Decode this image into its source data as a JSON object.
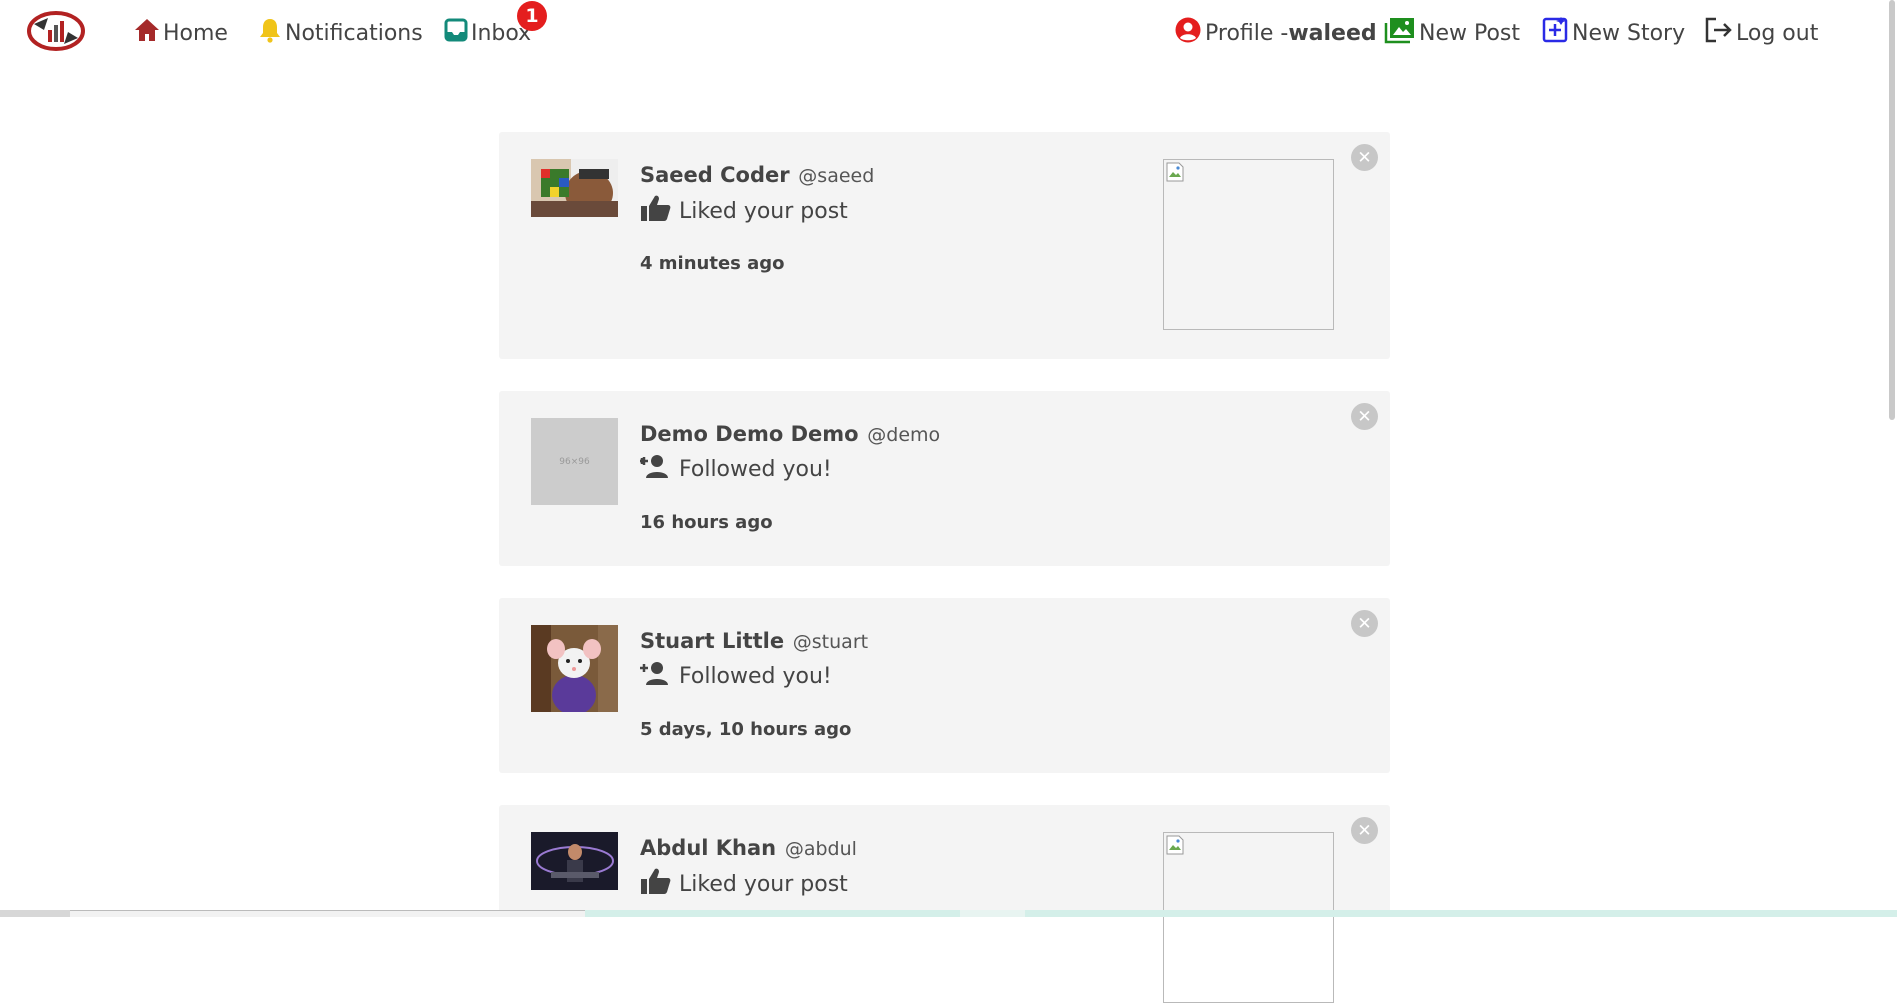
{
  "nav": {
    "home": "Home",
    "notifications": "Notifications",
    "inbox": "Inbox",
    "inbox_badge": "1",
    "profile_prefix": "Profile -",
    "profile_user": "waleed",
    "new_post": "New Post",
    "new_story": "New Story",
    "logout": "Log out"
  },
  "notifications": [
    {
      "name": "Saeed Coder",
      "handle": "@saeed",
      "action": "Liked your post",
      "time": "4 minutes ago",
      "type": "like",
      "has_post_image": true
    },
    {
      "name": "Demo Demo Demo",
      "handle": "@demo",
      "action": "Followed you!",
      "time": "16 hours ago",
      "type": "follow",
      "avatar_placeholder": "96×96"
    },
    {
      "name": "Stuart Little",
      "handle": "@stuart",
      "action": "Followed you!",
      "time": "5 days, 10 hours ago",
      "type": "follow"
    },
    {
      "name": "Abdul Khan",
      "handle": "@abdul",
      "action": "Liked your post",
      "time": "",
      "type": "like",
      "has_post_image": true
    }
  ],
  "close_symbol": "✕",
  "colors": {
    "home_icon": "#a52a2a",
    "bell_icon": "#f0c419",
    "inbox_icon": "#138a7a",
    "profile_icon": "#e41e1e",
    "new_post_icon": "#1e8f1e",
    "new_story_icon": "#2a2ae6",
    "badge": "#e41e1e",
    "card_bg": "#f4f4f4"
  }
}
